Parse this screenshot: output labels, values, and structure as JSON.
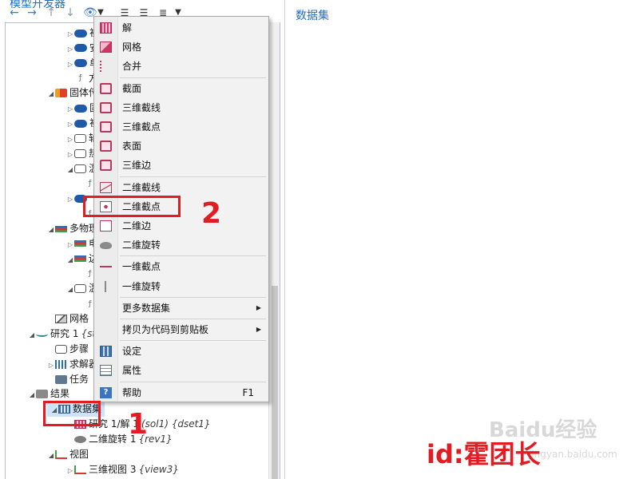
{
  "left_pane": {
    "title": "模型开发器",
    "toolbar_icons": [
      "arrow-left-icon",
      "arrow-right-icon",
      "arrow-up-icon",
      "arrow-down-icon",
      "eye-icon",
      "chevron-down-icon",
      "expand-all-icon",
      "collapse-all-icon",
      "list-icon",
      "chevron-down-icon"
    ],
    "tree": [
      {
        "label": "初",
        "icon": "blue-node-icon",
        "indent": 4,
        "expander": "▷"
      },
      {
        "label": "安",
        "icon": "blue-node-icon",
        "indent": 4,
        "expander": "▷"
      },
      {
        "label": "单",
        "icon": "blue-node-icon",
        "indent": 4,
        "expander": "▷"
      },
      {
        "label": "方",
        "icon": "equation-icon",
        "indent": 4,
        "expander": ""
      },
      {
        "label": "固体传",
        "icon": "solid-heat-icon",
        "indent": 2,
        "expander": "◢"
      },
      {
        "label": "固",
        "icon": "blue-node-icon",
        "indent": 4,
        "expander": "▷"
      },
      {
        "label": "初",
        "icon": "blue-node-icon",
        "indent": 4,
        "expander": "▷"
      },
      {
        "label": "轴",
        "icon": "outline-node-icon",
        "indent": 4,
        "expander": "▷"
      },
      {
        "label": "热",
        "icon": "outline-node-icon",
        "indent": 4,
        "expander": "▷"
      },
      {
        "label": "温",
        "icon": "outline-node-icon",
        "indent": 4,
        "expander": "◢"
      },
      {
        "label": "",
        "icon": "equation-icon",
        "indent": 5,
        "expander": ""
      },
      {
        "label": "",
        "icon": "blue-node-icon",
        "indent": 4,
        "expander": "▷"
      },
      {
        "label": "",
        "icon": "equation-icon",
        "indent": 5,
        "expander": ""
      },
      {
        "label": "多物理",
        "icon": "multiphysics-icon",
        "indent": 2,
        "expander": "◢"
      },
      {
        "label": "电",
        "icon": "multiphysics-icon",
        "indent": 4,
        "expander": "▷"
      },
      {
        "label": "边",
        "icon": "multiphysics-icon",
        "indent": 4,
        "expander": "◢"
      },
      {
        "label": "",
        "icon": "equation-icon",
        "indent": 5,
        "expander": ""
      },
      {
        "label": "温",
        "icon": "thermometer-icon",
        "indent": 4,
        "expander": "◢"
      },
      {
        "label": "",
        "icon": "equation-icon",
        "indent": 5,
        "expander": ""
      },
      {
        "label": "网格",
        "icon": "mesh-icon",
        "indent": 2,
        "expander": ""
      },
      {
        "label": "研究 1",
        "tag": "{st",
        "icon": "study-icon",
        "indent": 0,
        "expander": "◢"
      },
      {
        "label": "步骤",
        "icon": "step-icon",
        "indent": 2,
        "expander": ""
      },
      {
        "label": "求解器",
        "icon": "solver-icon",
        "indent": 2,
        "expander": "▷"
      },
      {
        "label": "任务",
        "icon": "job-icon",
        "indent": 2,
        "expander": ""
      },
      {
        "label": "结果",
        "icon": "results-icon",
        "indent": 0,
        "expander": "◢"
      },
      {
        "label": "数据集",
        "icon": "dataset-icon",
        "indent": 2,
        "expander": "◢",
        "selected": true
      },
      {
        "label": "研究 1/解 1",
        "tag": "(sol1) {dset1}",
        "icon": "solution-icon",
        "indent": 4,
        "expander": ""
      },
      {
        "label": "二维旋转 1",
        "tag": "{rev1}",
        "icon": "revolve-icon",
        "indent": 4,
        "expander": ""
      },
      {
        "label": "视图",
        "icon": "view-icon",
        "indent": 2,
        "expander": "◢"
      },
      {
        "label": "三维视图 3",
        "tag": "{view3}",
        "icon": "view3d-icon",
        "indent": 4,
        "expander": "▷"
      }
    ]
  },
  "right_pane": {
    "title": "数据集"
  },
  "context_menu": {
    "groups": [
      [
        {
          "label": "解",
          "icon": "solution-icon"
        },
        {
          "label": "网格",
          "icon": "mesh-icon"
        },
        {
          "label": "合并",
          "icon": "join-icon"
        }
      ],
      [
        {
          "label": "截面",
          "icon": "cut-plane-icon"
        },
        {
          "label": "三维截线",
          "icon": "cut-line-3d-icon"
        },
        {
          "label": "三维截点",
          "icon": "cut-point-3d-icon"
        },
        {
          "label": "表面",
          "icon": "surface-icon"
        },
        {
          "label": "三维边",
          "icon": "edge-3d-icon"
        }
      ],
      [
        {
          "label": "二维截线",
          "icon": "cut-line-2d-icon"
        },
        {
          "label": "二维截点",
          "icon": "cut-point-2d-icon"
        },
        {
          "label": "二维边",
          "icon": "edge-2d-icon"
        },
        {
          "label": "二维旋转",
          "icon": "revolution-2d-icon"
        }
      ],
      [
        {
          "label": "一维截点",
          "icon": "cut-point-1d-icon"
        },
        {
          "label": "一维旋转",
          "icon": "revolution-1d-icon"
        }
      ],
      [
        {
          "label": "更多数据集",
          "icon": "",
          "submenu": true
        }
      ],
      [
        {
          "label": "拷贝为代码到剪贴板",
          "icon": "",
          "submenu": true
        }
      ],
      [
        {
          "label": "设定",
          "icon": "settings-icon"
        },
        {
          "label": "属性",
          "icon": "properties-icon"
        }
      ],
      [
        {
          "label": "帮助",
          "icon": "help-icon",
          "shortcut": "F1"
        }
      ]
    ]
  },
  "annotations": {
    "step1_label": "1",
    "step2_label": "2",
    "color": "#e31b23"
  },
  "watermark": {
    "author": "id:霍团长",
    "site": "Baidu经验",
    "site_sub": "jingyan.baidu.com"
  }
}
